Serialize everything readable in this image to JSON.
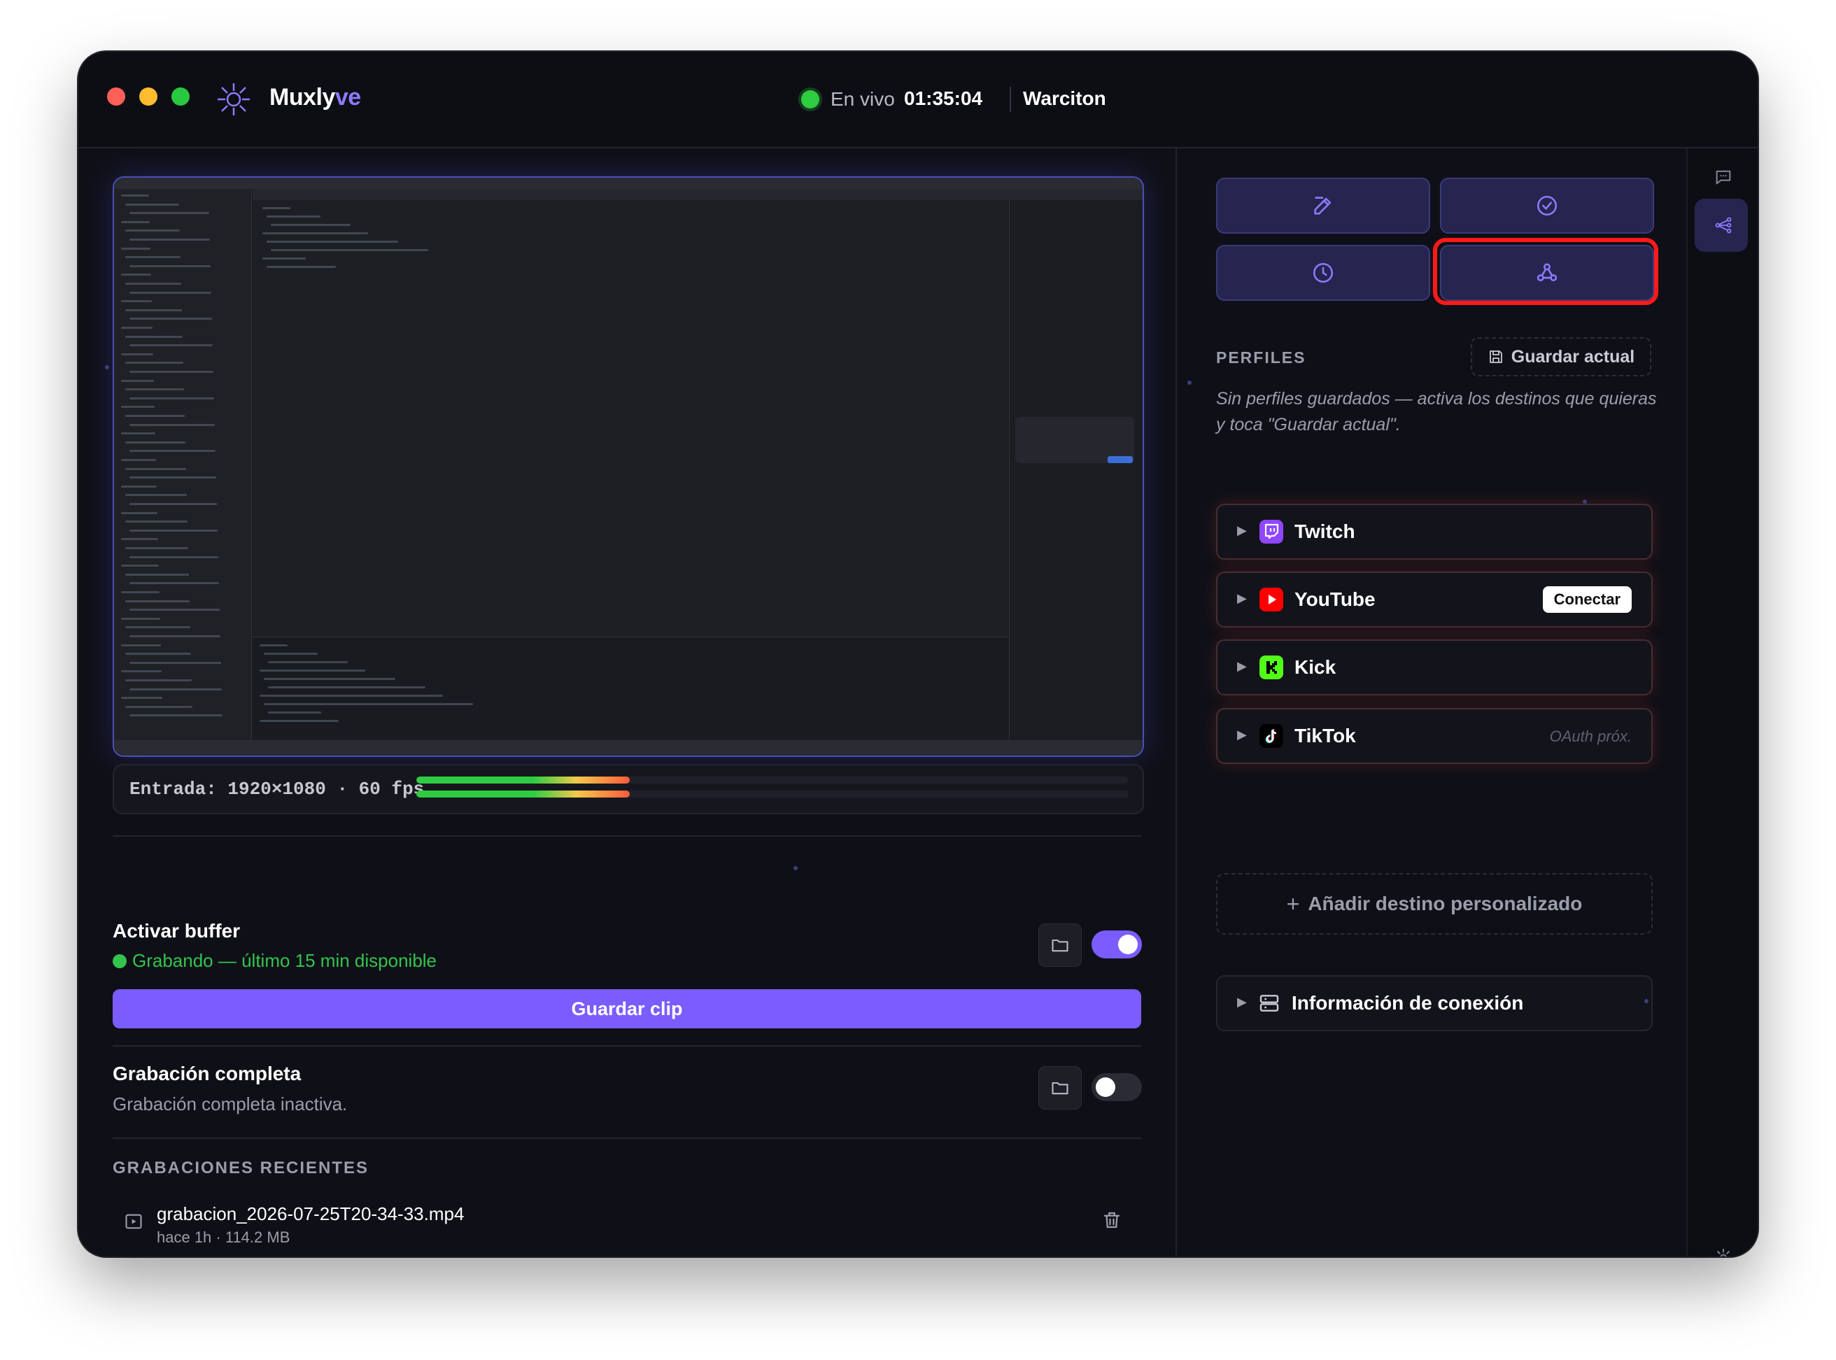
{
  "app": {
    "brand_main": "Muxly",
    "brand_accent": "ve",
    "live_label": "En vivo",
    "live_time": "01:35:04",
    "channel": "Warciton"
  },
  "preview": {
    "input_label": "Entrada: 1920×1080 · 60 fps",
    "meter_levels": [
      0.3,
      0.3
    ]
  },
  "buffer": {
    "title": "Activar buffer",
    "status": "Grabando — último 15 min disponible",
    "enabled": true,
    "save_clip_label": "Guardar clip"
  },
  "full_recording": {
    "title": "Grabación completa",
    "status": "Grabación completa inactiva.",
    "enabled": false
  },
  "recent": {
    "caption": "GRABACIONES RECIENTES",
    "items": [
      {
        "name": "grabacion_2026-07-25T20-34-33.mp4",
        "meta": "hace 1h · 114.2 MB"
      }
    ]
  },
  "tools": [
    {
      "icon": "edit-icon"
    },
    {
      "icon": "check-circle-icon"
    },
    {
      "icon": "clock-icon"
    },
    {
      "icon": "webhook-icon",
      "highlighted": true
    }
  ],
  "profiles": {
    "caption": "PERFILES",
    "save_current": "Guardar actual",
    "hint": "Sin perfiles guardados — activa los destinos que quieras y toca \"Guardar actual\"."
  },
  "destinations": [
    {
      "name": "Twitch",
      "icon": "twitch-icon",
      "color": "#9146ff"
    },
    {
      "name": "YouTube",
      "icon": "youtube-icon",
      "color": "#ff0000",
      "action": "Conectar"
    },
    {
      "name": "Kick",
      "icon": "kick-icon",
      "color": "#53fc18"
    },
    {
      "name": "TikTok",
      "icon": "tiktok-icon",
      "color": "#000000",
      "note": "OAuth próx."
    }
  ],
  "add_destination": "Añadir destino personalizado",
  "connection_info": "Información de conexión",
  "colors": {
    "accent": "#7b5cff",
    "live": "#2ecc40",
    "highlight": "#ff1a1a"
  }
}
